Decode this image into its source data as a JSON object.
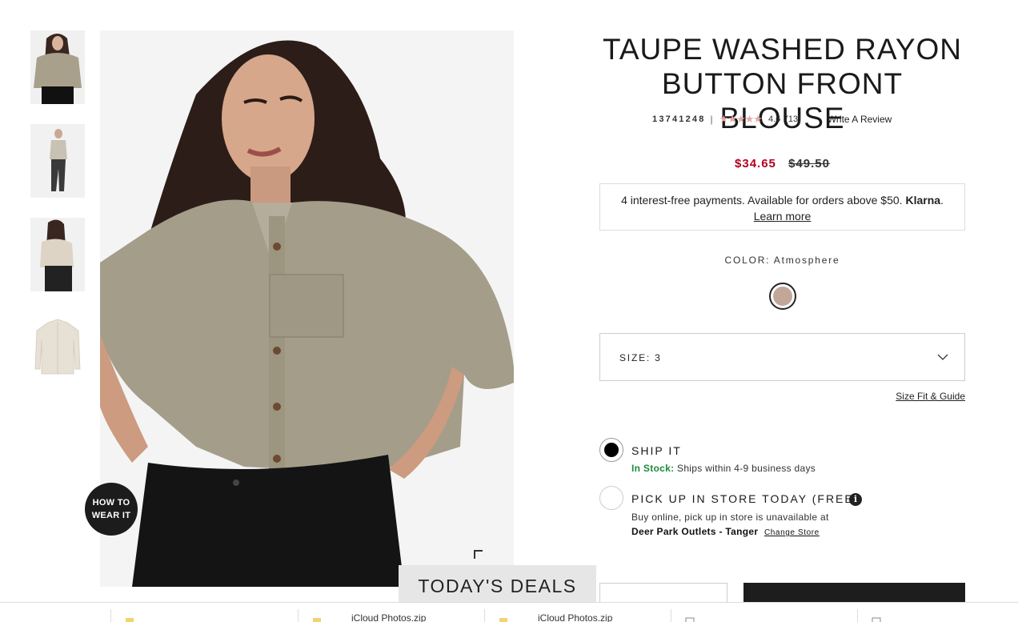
{
  "product": {
    "title_line1": "TAUPE WASHED RAYON",
    "title_line2": "BUTTON FRONT BLOUSE",
    "sku": "13741248",
    "separator": "|",
    "stars": "★★★★★",
    "rating": "4.6",
    "review_count": "(13)",
    "write_review": "Write A Review",
    "price_sale": "$34.65",
    "price_original": "$49.50"
  },
  "klarna": {
    "text": "4 interest-free payments. Available for orders above $50.",
    "brand": "Klarna",
    "period": ".",
    "learn_more": "Learn more"
  },
  "color": {
    "label": "COLOR:",
    "value": "Atmosphere",
    "swatch_color": "#c3a69a"
  },
  "size": {
    "label": "SIZE:",
    "value": "3",
    "guide_link": "Size Fit & Guide"
  },
  "fulfillment": {
    "ship_title": "SHIP IT",
    "ship_stock": "In Stock:",
    "ship_detail": "Ships within 4-9 business days",
    "pickup_title": "PICK UP IN STORE TODAY (FREE)",
    "pickup_info_icon": "i",
    "pickup_note": "Buy online, pick up in store is unavailable at",
    "pickup_store": "Deer Park Outlets - Tanger",
    "change_store": "Change Store"
  },
  "overlay": {
    "how_to_line1": "HOW TO",
    "how_to_line2": "WEAR IT",
    "deals": "TODAY'S DEALS"
  },
  "downloads": [
    {
      "name": ""
    },
    {
      "name": "iCloud Photos.zip"
    },
    {
      "name": "iCloud Photos.zip"
    },
    {
      "name": ""
    },
    {
      "name": ""
    }
  ],
  "colors": {
    "sale": "#b2001e",
    "in_stock": "#1c8a3c",
    "star": "#e3a9a3"
  }
}
